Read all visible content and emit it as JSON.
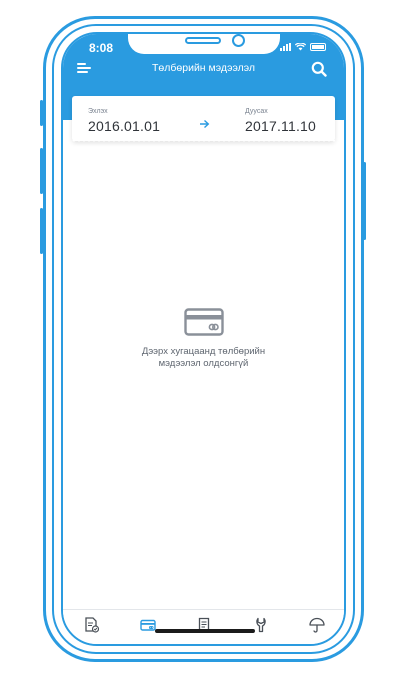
{
  "status_bar": {
    "time": "8:08"
  },
  "header": {
    "title": "Төлбөрийн мэдээлэл",
    "menu_icon": "hamburger-menu-icon",
    "search_icon": "search-icon"
  },
  "date_range": {
    "start_label": "Эхлэх",
    "start_value": "2016.01.01",
    "end_label": "Дуусах",
    "end_value": "2017.11.10",
    "arrow_icon": "arrow-right-icon"
  },
  "empty_state": {
    "icon": "credit-card-icon",
    "line1": "Дээрх хугацаанд төлбөрийн",
    "line2": "мэдээлэл олдсонгүй"
  },
  "tab_bar": {
    "tabs": [
      {
        "icon": "document-check-icon",
        "active": false
      },
      {
        "icon": "credit-card-icon",
        "active": true
      },
      {
        "icon": "receipt-icon",
        "active": false
      },
      {
        "icon": "wrench-icon",
        "active": false
      },
      {
        "icon": "umbrella-icon",
        "active": false
      }
    ]
  },
  "colors": {
    "accent": "#2a9be0",
    "text_primary": "#30343a",
    "text_secondary": "#7a8390",
    "icon_gray": "#8a9099"
  }
}
